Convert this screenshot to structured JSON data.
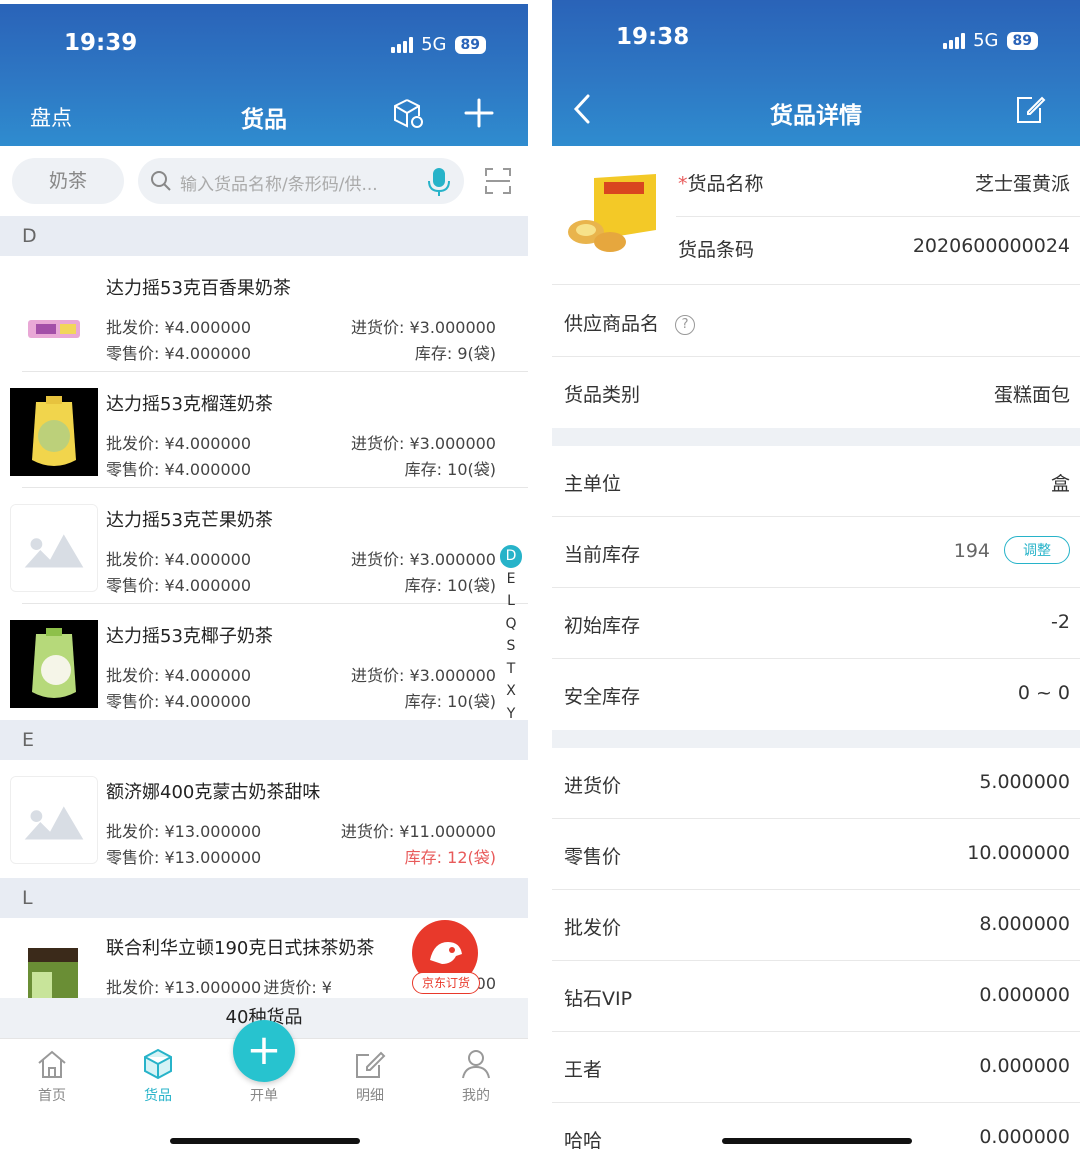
{
  "left": {
    "status": {
      "time": "19:39",
      "network": "5G",
      "battery": "89"
    },
    "nav": {
      "left": "盘点",
      "title": "货品"
    },
    "search": {
      "chip": "奶茶",
      "placeholder": "输入货品名称/条形码/供..."
    },
    "sections": [
      {
        "letter": "D",
        "items": [
          {
            "name": "达力摇53克百香果奶茶",
            "wholesale": "批发价: ¥4.000000",
            "retail": "零售价: ¥4.000000",
            "purchase": "进货价: ¥3.000000",
            "stock": "库存: 9(袋)"
          },
          {
            "name": "达力摇53克榴莲奶茶",
            "wholesale": "批发价: ¥4.000000",
            "retail": "零售价: ¥4.000000",
            "purchase": "进货价: ¥3.000000",
            "stock": "库存: 10(袋)"
          },
          {
            "name": "达力摇53克芒果奶茶",
            "wholesale": "批发价: ¥4.000000",
            "retail": "零售价: ¥4.000000",
            "purchase": "进货价: ¥3.000000",
            "stock": "库存: 10(袋)"
          },
          {
            "name": "达力摇53克椰子奶茶",
            "wholesale": "批发价: ¥4.000000",
            "retail": "零售价: ¥4.000000",
            "purchase": "进货价: ¥3.000000",
            "stock": "库存: 10(袋)"
          }
        ]
      },
      {
        "letter": "E",
        "items": [
          {
            "name": "额济娜400克蒙古奶茶甜味",
            "wholesale": "批发价: ¥13.000000",
            "retail": "零售价: ¥13.000000",
            "purchase": "进货价: ¥11.000000",
            "stock": "库存: 12(袋)"
          }
        ]
      },
      {
        "letter": "L",
        "items": [
          {
            "name": "联合利华立顿190克日式抹茶奶茶",
            "wholesale": "批发价: ¥13.000000",
            "purchase": "进货价: ¥",
            "purchase_tail": "00"
          }
        ]
      }
    ],
    "index": [
      "D",
      "E",
      "L",
      "Q",
      "S",
      "T",
      "X",
      "Y"
    ],
    "jd_label": "京东订货",
    "count": "40种货品",
    "tabs": [
      "首页",
      "货品",
      "开单",
      "明细",
      "我的"
    ],
    "accent": "#27b3c9"
  },
  "right": {
    "status": {
      "time": "19:38",
      "network": "5G",
      "battery": "89"
    },
    "nav": {
      "title": "货品详情"
    },
    "top": {
      "name_key": "货品名称",
      "name_required": "*",
      "name_value": "芝士蛋黄派",
      "barcode_key": "货品条码",
      "barcode_value": "2020600000024"
    },
    "rows1": [
      {
        "k": "供应商品名",
        "v": ""
      },
      {
        "k": "货品类别",
        "v": "蛋糕面包"
      }
    ],
    "rows2": [
      {
        "k": "主单位",
        "v": "盒"
      },
      {
        "k": "当前库存",
        "v": "194",
        "action": "调整"
      },
      {
        "k": "初始库存",
        "v": "-2"
      },
      {
        "k": "安全库存",
        "v": "0 ~ 0"
      }
    ],
    "rows3": [
      {
        "k": "进货价",
        "v": "5.000000"
      },
      {
        "k": "零售价",
        "v": "10.000000"
      },
      {
        "k": "批发价",
        "v": "8.000000"
      },
      {
        "k": "钻石VIP",
        "v": "0.000000"
      },
      {
        "k": "王者",
        "v": "0.000000"
      },
      {
        "k": "哈哈",
        "v": "0.000000"
      }
    ]
  }
}
